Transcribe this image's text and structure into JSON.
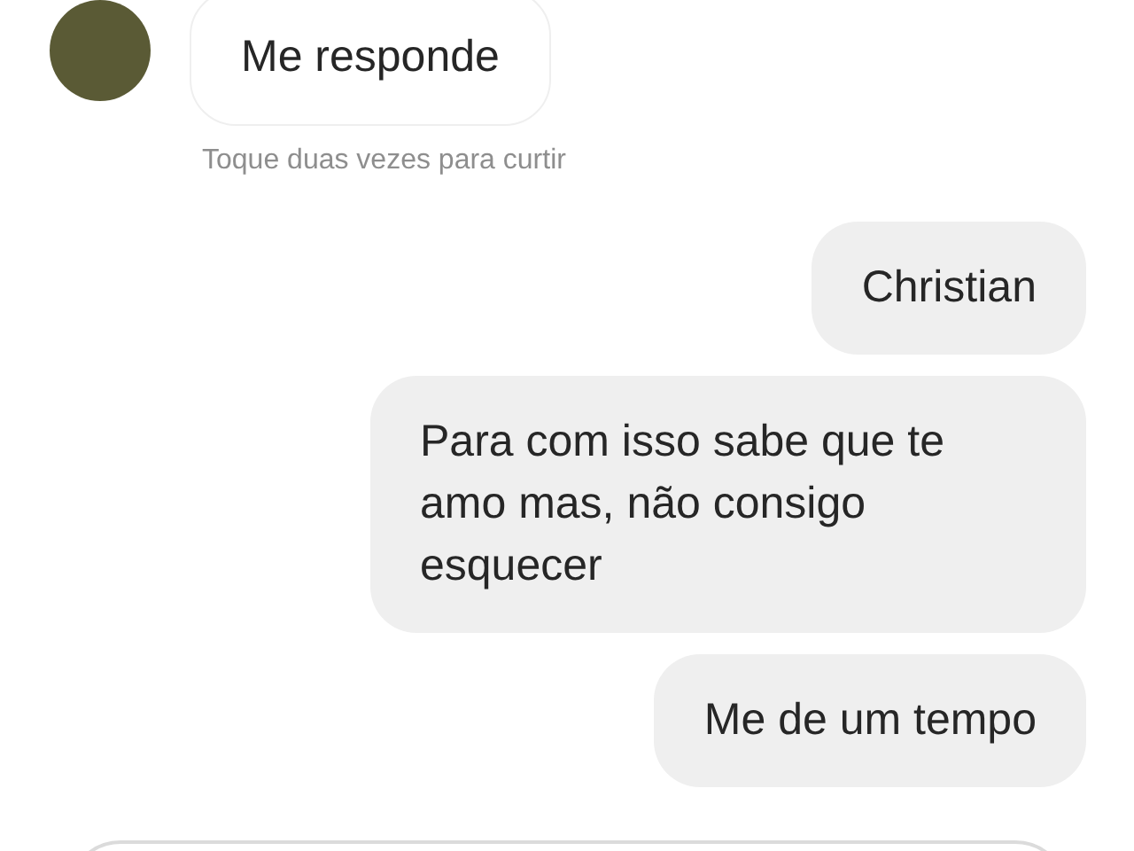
{
  "messages": [
    {
      "kind": "received",
      "text": "Me responde",
      "hint": "Toque duas vezes para curtir"
    },
    {
      "kind": "sent",
      "text": "Christian"
    },
    {
      "kind": "sent",
      "text": "Para com isso sabe que te amo mas, não consigo esquecer"
    },
    {
      "kind": "sent",
      "text": "Me de um tempo"
    }
  ]
}
